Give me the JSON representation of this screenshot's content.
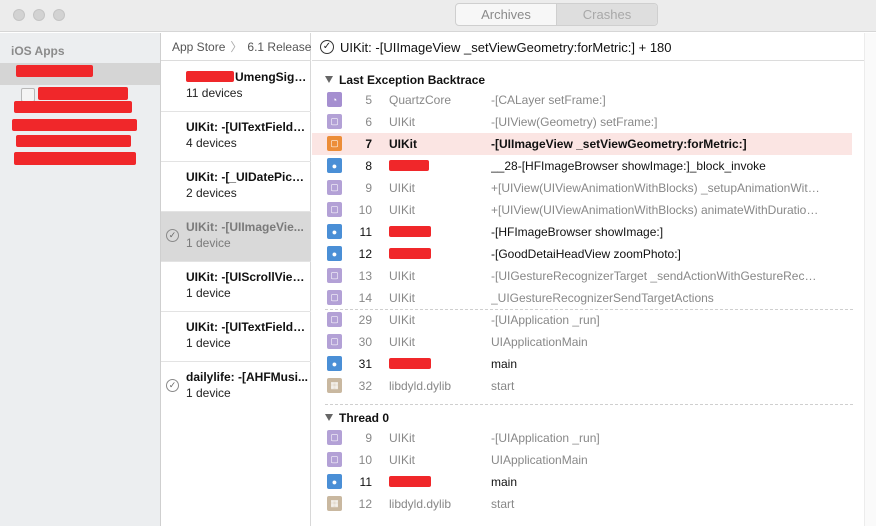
{
  "toolbar": {
    "tabs": [
      {
        "label": "Archives",
        "selected": false
      },
      {
        "label": "Crashes",
        "selected": true
      }
    ]
  },
  "sidebar": {
    "header": "iOS Apps"
  },
  "crash_list": {
    "breadcrumb": [
      "App Store",
      "6.1 Release"
    ],
    "items": [
      {
        "title": "UmengSign...",
        "subtitle": "11 devices",
        "selected": false,
        "resolved": false
      },
      {
        "title": "UIKit: -[UITextField f...",
        "subtitle": "4 devices",
        "selected": false,
        "resolved": false
      },
      {
        "title": "UIKit: -[_UIDatePick...",
        "subtitle": "2 devices",
        "selected": false,
        "resolved": false
      },
      {
        "title": "UIKit: -[UIImageVie...",
        "subtitle": "1 device",
        "selected": true,
        "resolved": true
      },
      {
        "title": "UIKit: -[UIScrollView...",
        "subtitle": "1 device",
        "selected": false,
        "resolved": false
      },
      {
        "title": "UIKit: -[UITextField f...",
        "subtitle": "1 device",
        "selected": false,
        "resolved": false
      },
      {
        "title": "dailylife: -[AHFMusi...",
        "subtitle": "1 device",
        "selected": false,
        "resolved": true
      }
    ]
  },
  "detail": {
    "title": "UIKit: -[UIImageView _setViewGeometry:forMetric:] + 180",
    "sections": [
      {
        "title": "Last Exception Backtrace",
        "frames": [
          {
            "num": "5",
            "binary": "QuartzCore",
            "symbol": "-[CALayer setFrame:]",
            "kind": "system"
          },
          {
            "num": "6",
            "binary": "UIKit",
            "symbol": "-[UIView(Geometry) setFrame:]",
            "kind": "system"
          },
          {
            "num": "7",
            "binary": "UIKit",
            "symbol": "-[UIImageView _setViewGeometry:forMetric:]",
            "kind": "crash"
          },
          {
            "num": "8",
            "binary": "",
            "symbol": "__28-[HFImageBrowser showImage:]_block_invoke",
            "kind": "user"
          },
          {
            "num": "9",
            "binary": "UIKit",
            "symbol": "+[UIView(UIViewAnimationWithBlocks) _setupAnimationWithD...",
            "kind": "system"
          },
          {
            "num": "10",
            "binary": "UIKit",
            "symbol": "+[UIView(UIViewAnimationWithBlocks) animateWithDuration:a...",
            "kind": "system"
          },
          {
            "num": "11",
            "binary": "",
            "symbol": "-[HFImageBrowser showImage:]",
            "kind": "user"
          },
          {
            "num": "12",
            "binary": "",
            "symbol": "-[GoodDetaiHeadView zoomPhoto:]",
            "kind": "user"
          },
          {
            "num": "13",
            "binary": "UIKit",
            "symbol": "-[UIGestureRecognizerTarget _sendActionWithGestureRecogni...",
            "kind": "system"
          },
          {
            "num": "14",
            "binary": "UIKit",
            "symbol": "_UIGestureRecognizerSendTargetActions",
            "kind": "system"
          },
          {
            "num": "29",
            "binary": "UIKit",
            "symbol": "-[UIApplication _run]",
            "kind": "system"
          },
          {
            "num": "30",
            "binary": "UIKit",
            "symbol": "UIApplicationMain",
            "kind": "system"
          },
          {
            "num": "31",
            "binary": "",
            "symbol": "main",
            "kind": "user"
          },
          {
            "num": "32",
            "binary": "libdyld.dylib",
            "symbol": "start",
            "kind": "lib"
          }
        ]
      },
      {
        "title": "Thread 0",
        "frames": [
          {
            "num": "9",
            "binary": "UIKit",
            "symbol": "-[UIApplication _run]",
            "kind": "system"
          },
          {
            "num": "10",
            "binary": "UIKit",
            "symbol": "UIApplicationMain",
            "kind": "system"
          },
          {
            "num": "11",
            "binary": "",
            "symbol": "main",
            "kind": "user"
          },
          {
            "num": "12",
            "binary": "libdyld.dylib",
            "symbol": "start",
            "kind": "lib"
          }
        ]
      }
    ]
  },
  "colors": {
    "redaction": "#f0272a",
    "crash_highlight": "#fbe5e3",
    "user_frame_icon": "#4a8fd6",
    "system_frame_icon": "#b3a1d6",
    "crash_frame_icon": "#ec8d38"
  }
}
